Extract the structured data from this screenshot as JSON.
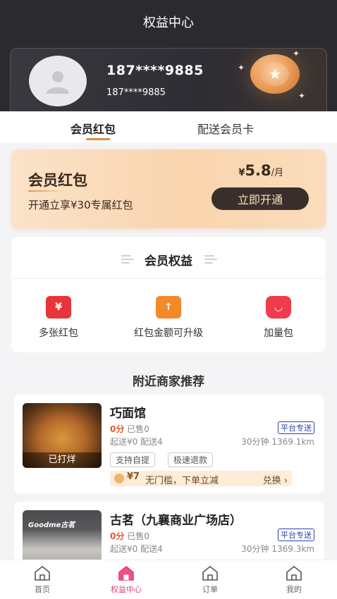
{
  "header": {
    "title": "权益中心"
  },
  "profile": {
    "phone_main": "187****9885",
    "phone_sub": "187****9885"
  },
  "tabs": [
    {
      "label": "会员红包",
      "active": true
    },
    {
      "label": "配送会员卡",
      "active": false
    }
  ],
  "vip": {
    "title": "会员红包",
    "desc": "开通立享¥30专属红包",
    "currency": "¥",
    "price": "5.8",
    "period": "/月",
    "button": "立即开通"
  },
  "rights": {
    "title": "会员权益",
    "items": [
      {
        "label": "多张红包",
        "icon": "red-envelope-icon",
        "color": "#e8343a"
      },
      {
        "label": "红包金额可升级",
        "icon": "upgrade-icon",
        "color": "#f28a2a"
      },
      {
        "label": "加量包",
        "icon": "gift-bag-icon",
        "color": "#ee3c4c"
      }
    ]
  },
  "section_title": "附近商家推荐",
  "shops": [
    {
      "name": "巧面馆",
      "image_tag": "已打烊",
      "score": "0分",
      "sold": "已售0",
      "platform_tag": "平台专送",
      "fee": "起送¥0 配送4",
      "distance": "30分钟 1369.1km",
      "services": [
        "支持自提",
        "极速退款"
      ],
      "coupon": {
        "amount": "¥7",
        "desc": "无门槛，下单立减",
        "action": "兑换"
      }
    },
    {
      "name": "古茗（九襄商业广场店）",
      "image_sign": "Goodme古茗",
      "score": "0分",
      "sold": "已售0",
      "platform_tag": "平台专送",
      "fee": "起送¥0 配送4",
      "distance": "30分钟 1369.3km"
    }
  ],
  "nav": [
    {
      "label": "首页",
      "active": false
    },
    {
      "label": "权益中心",
      "active": true
    },
    {
      "label": "订单",
      "active": false
    },
    {
      "label": "我的",
      "active": false
    }
  ],
  "colors": {
    "accent": "#e0407a",
    "dark": "#2b2a2f",
    "gold": "#e08a3a"
  }
}
